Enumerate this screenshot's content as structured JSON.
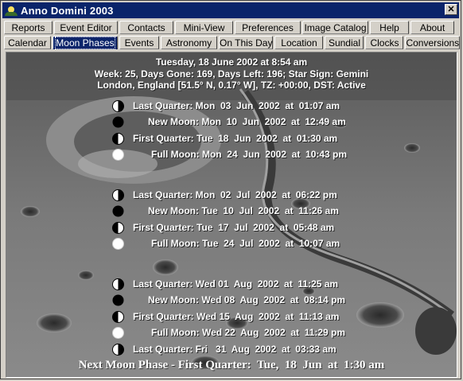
{
  "window": {
    "title": "Anno Domini 2003"
  },
  "tabs_row1": [
    "Reports",
    "Event Editor",
    "Contacts",
    "Mini-View",
    "Preferences",
    "Image Catalog",
    "Help",
    "About"
  ],
  "tabs_row2": [
    "Calendar",
    "Moon Phases",
    "Events",
    "Astronomy",
    "On This Day",
    "Location",
    "Sundial",
    "Clocks",
    "Conversions"
  ],
  "active_tab": "Moon Phases",
  "header": {
    "line1": "Tuesday, 18 June 2002 at 8:54 am",
    "line2": "Week: 25, Days Gone: 169, Days Left: 196; Star Sign: Gemini",
    "line3": "London, England [51.5° N, 0.17° W], TZ: +00:00, DST: Active"
  },
  "phase_groups": [
    [
      {
        "icon": "last-quarter",
        "text": "Last Quarter: Mon  03  Jun  2002  at  01:07 am"
      },
      {
        "icon": "new-moon",
        "text": "New Moon: Mon  10  Jun  2002  at  12:49 am"
      },
      {
        "icon": "first-quarter",
        "text": "First Quarter: Tue  18  Jun  2002  at  01:30 am"
      },
      {
        "icon": "full-moon",
        "text": "Full Moon: Mon  24  Jun  2002  at  10:43 pm"
      }
    ],
    [
      {
        "icon": "last-quarter",
        "text": "Last Quarter: Mon  02  Jul  2002  at  06:22 pm"
      },
      {
        "icon": "new-moon",
        "text": "New Moon: Tue  10  Jul  2002  at  11:26 am"
      },
      {
        "icon": "first-quarter",
        "text": "First Quarter: Tue  17  Jul  2002  at  05:48 am"
      },
      {
        "icon": "full-moon",
        "text": "Full Moon: Tue  24  Jul  2002  at  10:07 am"
      }
    ],
    [
      {
        "icon": "last-quarter",
        "text": "Last Quarter: Wed 01  Aug  2002  at  11:25 am"
      },
      {
        "icon": "new-moon",
        "text": "New Moon: Wed 08  Aug  2002  at  08:14 pm"
      },
      {
        "icon": "first-quarter",
        "text": "First Quarter: Wed 15  Aug  2002  at  11:13 am"
      },
      {
        "icon": "full-moon",
        "text": "Full Moon: Wed 22  Aug  2002  at  11:29 pm"
      },
      {
        "icon": "last-quarter",
        "text": "Last Quarter: Fri   31  Aug  2002  at  03:33 am"
      }
    ]
  ],
  "next_phase": "Next Moon Phase - First Quarter:  Tue,  18  Jun  at  1:30 am"
}
